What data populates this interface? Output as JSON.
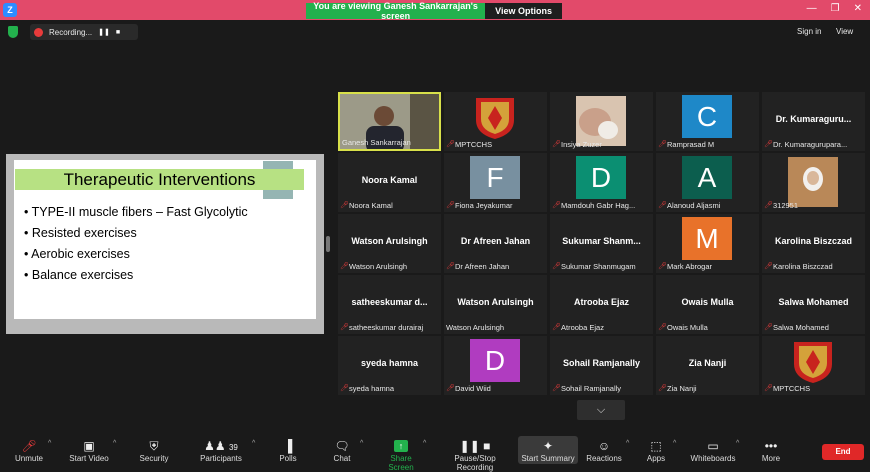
{
  "banner": {
    "message": "You are viewing Ganesh Sankarrajan's screen",
    "view_options": "View Options"
  },
  "app": {
    "logo": "Z"
  },
  "window_controls": {
    "minimize": "—",
    "maximize": "❐",
    "close": "✕"
  },
  "recording": {
    "label": "Recording...",
    "pause": "❚❚",
    "stop": "■"
  },
  "topbar": {
    "sign_in": "Sign in",
    "view": "View"
  },
  "slide": {
    "title": "Therapeutic Interventions",
    "bullets": [
      "TYPE-II muscle fibers – Fast Glycolytic",
      "Resisted exercises",
      "Aerobic exercises",
      "Balance exercises"
    ]
  },
  "participants": [
    {
      "label": "Ganesh Sankarrajan",
      "kind": "video",
      "active": true,
      "muted": false
    },
    {
      "label": "MPTCCHS",
      "kind": "logo",
      "muted": true
    },
    {
      "label": "Insiya Zuzer",
      "kind": "photo",
      "muted": true
    },
    {
      "label": "Ramprasad M",
      "kind": "initial",
      "initial": "C",
      "color": "#1e88c8",
      "muted": true
    },
    {
      "label": "Dr. Kumaragurupara...",
      "kind": "name",
      "name": "Dr.  Kumaraguru...",
      "muted": true
    },
    {
      "label": "Noora Kamal",
      "kind": "name",
      "name": "Noora Kamal",
      "muted": true
    },
    {
      "label": "Fiona Jeyakumar",
      "kind": "initial",
      "initial": "F",
      "color": "#7890a0",
      "muted": true
    },
    {
      "label": "Mamdouh Gabr Hag...",
      "kind": "initial",
      "initial": "D",
      "color": "#0b8f72",
      "muted": true
    },
    {
      "label": "Alanoud Aljasmi",
      "kind": "initial",
      "initial": "A",
      "color": "#0c5e4e",
      "muted": true
    },
    {
      "label": "312951",
      "kind": "photo2",
      "muted": true
    },
    {
      "label": "Watson Arulsingh",
      "kind": "name",
      "name": "Watson Arulsingh",
      "muted": true
    },
    {
      "label": "Dr Afreen Jahan",
      "kind": "name",
      "name": "Dr Afreen Jahan",
      "muted": true
    },
    {
      "label": "Sukumar Shanmugam",
      "kind": "name",
      "name": "Sukumar  Shanm...",
      "muted": true
    },
    {
      "label": "Mark Abrogar",
      "kind": "initial",
      "initial": "M",
      "color": "#e8722a",
      "muted": true
    },
    {
      "label": "Karolina Biszczad",
      "kind": "name",
      "name": "Karolina Biszczad",
      "muted": true
    },
    {
      "label": "satheeskumar durairaj",
      "kind": "name",
      "name": "satheeskumar  d...",
      "muted": true
    },
    {
      "label": "Watson Arulsingh",
      "kind": "name",
      "name": "Watson Arulsingh",
      "muted": false
    },
    {
      "label": "Atrooba Ejaz",
      "kind": "name",
      "name": "Atrooba Ejaz",
      "muted": true
    },
    {
      "label": "Owais Mulla",
      "kind": "name",
      "name": "Owais Mulla",
      "muted": true
    },
    {
      "label": "Salwa Mohamed",
      "kind": "name",
      "name": "Salwa Mohamed",
      "muted": true
    },
    {
      "label": "syeda hamna",
      "kind": "name",
      "name": "syeda hamna",
      "muted": true
    },
    {
      "label": "David Wiid",
      "kind": "initial",
      "initial": "D",
      "color": "#b03cc0",
      "muted": true
    },
    {
      "label": "Sohail Ramjanally",
      "kind": "name",
      "name": "Sohail Ramjanally",
      "muted": true
    },
    {
      "label": "Zia Nanji",
      "kind": "name",
      "name": "Zia Nanji",
      "muted": true
    },
    {
      "label": "MPTCCHS",
      "kind": "logo",
      "muted": true
    }
  ],
  "toolbar": {
    "unmute": "Unmute",
    "start_video": "Start Video",
    "security": "Security",
    "participants": "Participants",
    "participants_count": "39",
    "polls": "Polls",
    "chat": "Chat",
    "share_screen": "Share Screen",
    "pause_recording": "Pause/Stop Recording",
    "start_summary": "Start Summary",
    "reactions": "Reactions",
    "apps": "Apps",
    "whiteboards": "Whiteboards",
    "more": "More",
    "end": "End"
  },
  "colors": {
    "accent_green": "#23b14d",
    "end_red": "#e02828",
    "active_speaker": "#d8e04a"
  }
}
